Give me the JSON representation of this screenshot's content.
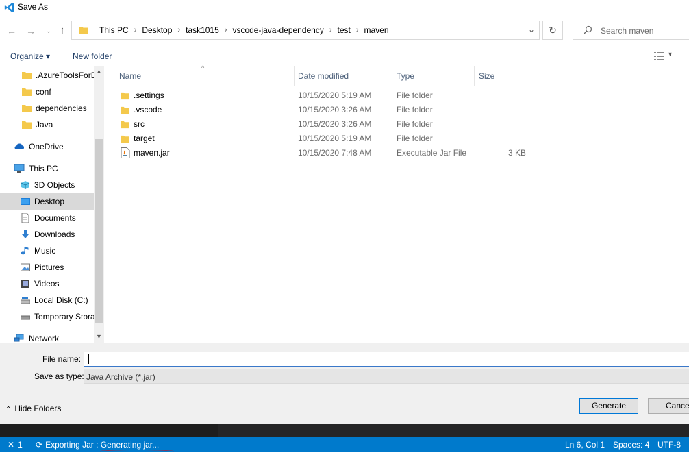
{
  "window": {
    "title": "Save As"
  },
  "nav": {
    "path": [
      "This PC",
      "Desktop",
      "task1015",
      "vscode-java-dependency",
      "test",
      "maven"
    ],
    "search_placeholder": "Search maven"
  },
  "toolbar": {
    "organize_label": "Organize ▾",
    "new_folder_label": "New folder"
  },
  "sidebar": {
    "items": [
      {
        "label": ".AzureToolsForEc",
        "icon": "folder-icon"
      },
      {
        "label": "conf",
        "icon": "folder-icon"
      },
      {
        "label": "dependencies",
        "icon": "folder-icon"
      },
      {
        "label": "Java",
        "icon": "folder-icon"
      },
      {
        "label": "OneDrive",
        "icon": "cloud-icon"
      },
      {
        "label": "This PC",
        "icon": "computer-icon"
      },
      {
        "label": "3D Objects",
        "icon": "cube-icon"
      },
      {
        "label": "Desktop",
        "icon": "desktop-icon",
        "selected": true
      },
      {
        "label": "Documents",
        "icon": "document-icon"
      },
      {
        "label": "Downloads",
        "icon": "download-icon"
      },
      {
        "label": "Music",
        "icon": "music-icon"
      },
      {
        "label": "Pictures",
        "icon": "picture-icon"
      },
      {
        "label": "Videos",
        "icon": "video-icon"
      },
      {
        "label": "Local Disk (C:)",
        "icon": "disk-icon"
      },
      {
        "label": "Temporary Stora",
        "icon": "drive-icon"
      },
      {
        "label": "Network",
        "icon": "network-icon"
      }
    ]
  },
  "files": {
    "columns": [
      "Name",
      "Date modified",
      "Type",
      "Size"
    ],
    "rows": [
      {
        "name": ".settings",
        "date": "10/15/2020 5:19 AM",
        "type": "File folder",
        "size": "",
        "icon": "folder-icon"
      },
      {
        "name": ".vscode",
        "date": "10/15/2020 3:26 AM",
        "type": "File folder",
        "size": "",
        "icon": "folder-icon"
      },
      {
        "name": "src",
        "date": "10/15/2020 3:26 AM",
        "type": "File folder",
        "size": "",
        "icon": "folder-icon"
      },
      {
        "name": "target",
        "date": "10/15/2020 5:19 AM",
        "type": "File folder",
        "size": "",
        "icon": "folder-icon"
      },
      {
        "name": "maven.jar",
        "date": "10/15/2020 7:48 AM",
        "type": "Executable Jar File",
        "size": "3 KB",
        "icon": "jar-file-icon"
      }
    ]
  },
  "form": {
    "file_name_label": "File name:",
    "file_name_value": "",
    "save_type_label": "Save as type:",
    "save_type_value": "Java Archive (*.jar)"
  },
  "buttons": {
    "hide_folders": "Hide Folders",
    "generate": "Generate",
    "cancel": "Cancel"
  },
  "statusbar": {
    "remote": "1",
    "task": "Exporting Jar : Generating jar...",
    "position": "Ln 6, Col 1",
    "spaces": "Spaces: 4",
    "encoding": "UTF-8"
  },
  "colors": {
    "accent": "#007acc",
    "folder": "#f4c94c",
    "selected": "#d9d9d9"
  }
}
